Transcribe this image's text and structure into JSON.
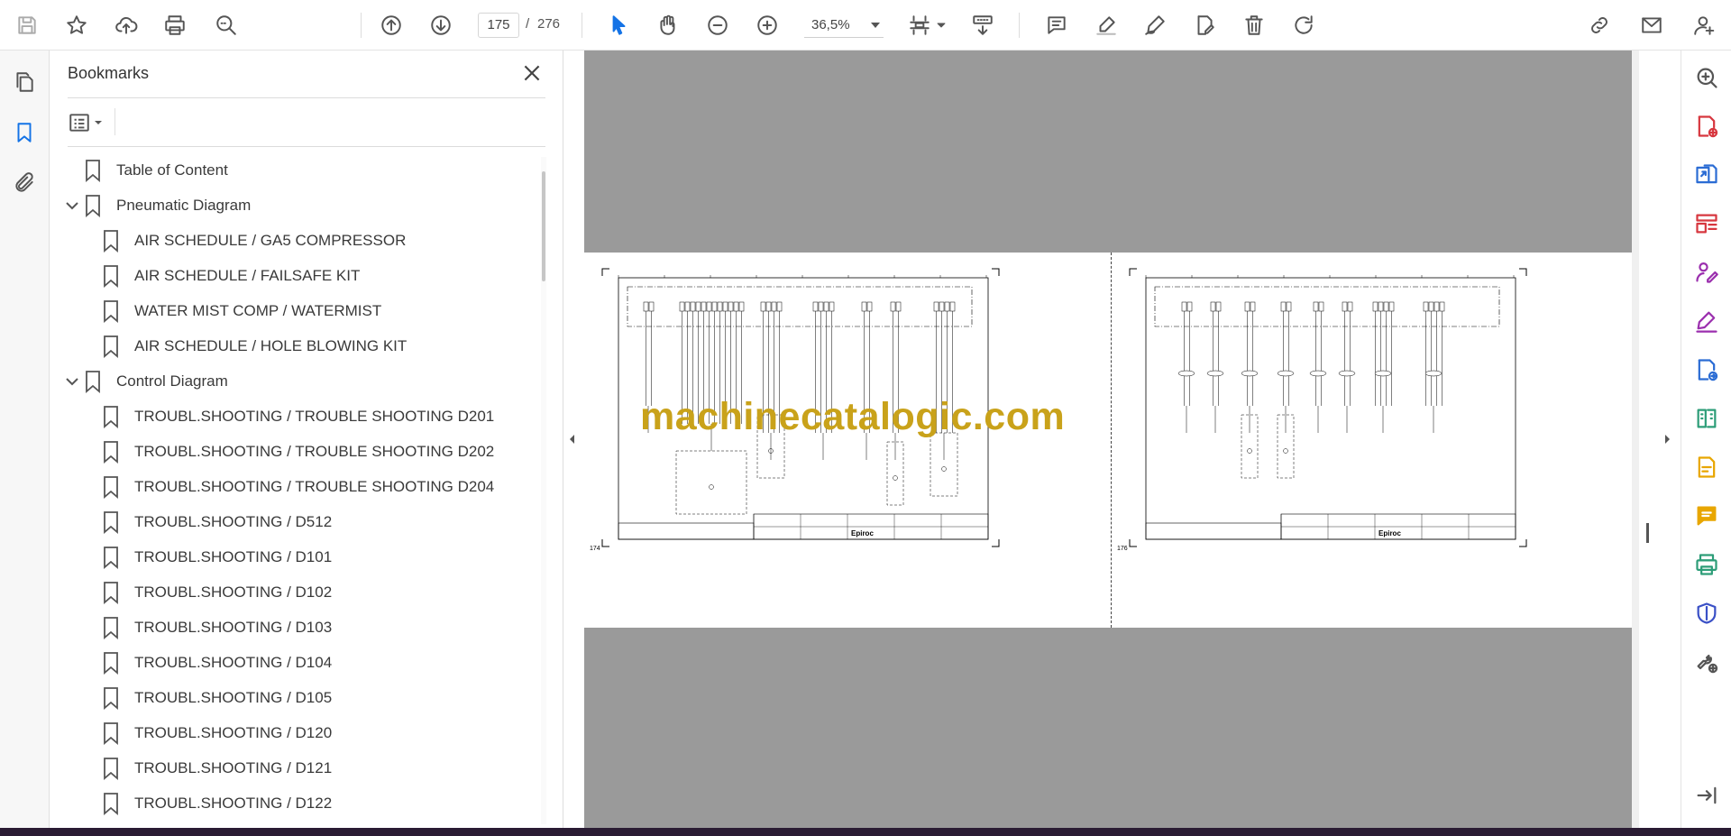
{
  "toolbar": {
    "page_current": "175",
    "page_separator": "/",
    "page_total": "276",
    "zoom": "36,5%",
    "icons": [
      "save-icon",
      "bookmark-star-icon",
      "upload-cloud-icon",
      "print-icon",
      "zoom-search-icon",
      "page-up-icon",
      "page-down-icon",
      "select-arrow-icon",
      "hand-icon",
      "zoom-out-icon",
      "zoom-in-icon",
      "page-fit-icon",
      "scroll-mode-icon",
      "comment-icon",
      "highlight-icon",
      "draw-icon",
      "fill-sign-icon",
      "delete-icon",
      "rotate-icon",
      "share-link-icon",
      "email-icon",
      "account-icon"
    ]
  },
  "left_rail": {
    "icons": [
      "page-thumbnails-icon",
      "bookmarks-icon",
      "attachments-icon"
    ]
  },
  "bookmarks": {
    "title": "Bookmarks",
    "items": [
      {
        "label": "Table of Content",
        "level": 0,
        "expandable": false
      },
      {
        "label": "Pneumatic Diagram",
        "level": 0,
        "expandable": true,
        "expanded": true
      },
      {
        "label": "AIR SCHEDULE / GA5 COMPRESSOR",
        "level": 1
      },
      {
        "label": "AIR SCHEDULE / FAILSAFE KIT",
        "level": 1
      },
      {
        "label": "WATER MIST COMP / WATERMIST",
        "level": 1
      },
      {
        "label": "AIR SCHEDULE / HOLE BLOWING KIT",
        "level": 1
      },
      {
        "label": "Control Diagram",
        "level": 0,
        "expandable": true,
        "expanded": true
      },
      {
        "label": "TROUBL.SHOOTING / TROUBLE SHOOTING D201",
        "level": 1
      },
      {
        "label": "TROUBL.SHOOTING / TROUBLE SHOOTING D202",
        "level": 1
      },
      {
        "label": "TROUBL.SHOOTING / TROUBLE SHOOTING D204",
        "level": 1
      },
      {
        "label": "TROUBL.SHOOTING / D512",
        "level": 1
      },
      {
        "label": "TROUBL.SHOOTING / D101",
        "level": 1
      },
      {
        "label": "TROUBL.SHOOTING / D102",
        "level": 1
      },
      {
        "label": "TROUBL.SHOOTING / D103",
        "level": 1
      },
      {
        "label": "TROUBL.SHOOTING / D104",
        "level": 1
      },
      {
        "label": "TROUBL.SHOOTING / D105",
        "level": 1
      },
      {
        "label": "TROUBL.SHOOTING / D120",
        "level": 1
      },
      {
        "label": "TROUBL.SHOOTING / D121",
        "level": 1
      },
      {
        "label": "TROUBL.SHOOTING / D122",
        "level": 1
      }
    ]
  },
  "document": {
    "watermark": "machinecatalogic.com",
    "left_page_number": "174",
    "right_page_number": "176",
    "title_block_brand": "Epiroc"
  },
  "right_rail": {
    "icons": [
      "zoom-page-icon",
      "create-pdf-icon",
      "export-pdf-icon",
      "organize-pages-icon",
      "request-signature-icon",
      "fill-sign-icon",
      "export-convert-icon",
      "compare-files-icon",
      "edit-pdf-icon",
      "comment-icon",
      "print-production-icon",
      "protect-icon",
      "more-tools-icon",
      "expand-panel-icon"
    ],
    "colors": {
      "red": "#d7373f",
      "blue": "#2b6cd4",
      "purple": "#9b2fae",
      "yellow": "#e8a600",
      "green": "#2d9d78",
      "navy": "#3a50c6",
      "gray": "#555555"
    }
  }
}
